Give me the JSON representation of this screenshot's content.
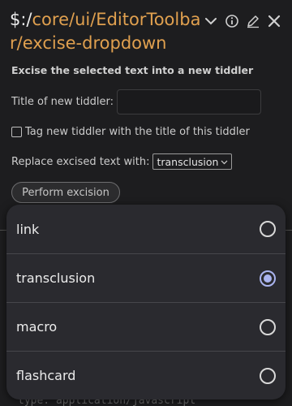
{
  "tiddler": {
    "title_prefix": "$:/",
    "title_rest": "core/ui/EditorToolbar/excise-dropdown",
    "controls": [
      {
        "name": "chevron-down-icon",
        "label": "more"
      },
      {
        "name": "info-icon",
        "label": "info"
      },
      {
        "name": "edit-icon",
        "label": "edit"
      },
      {
        "name": "close-icon",
        "label": "close"
      }
    ]
  },
  "excise": {
    "subtitle": "Excise the selected text into a new tiddler",
    "title_label": "Title of new tiddler:",
    "title_value": "",
    "tag_label": "Tag new tiddler with the title of this tiddler",
    "tag_checked": false,
    "replace_label": "Replace excised text with:",
    "replace_selected": "transclusion",
    "perform_button": "Perform excision"
  },
  "background_text": "type: application/javascript",
  "dropdown": {
    "options": [
      {
        "label": "link",
        "selected": false
      },
      {
        "label": "transclusion",
        "selected": true
      },
      {
        "label": "macro",
        "selected": false
      },
      {
        "label": "flashcard",
        "selected": false
      }
    ]
  },
  "colors": {
    "background": "#1d1d1f",
    "title_accent": "#e0a04f",
    "sheet": "#2a2a2f",
    "radio_selected": "#aab4ef"
  }
}
